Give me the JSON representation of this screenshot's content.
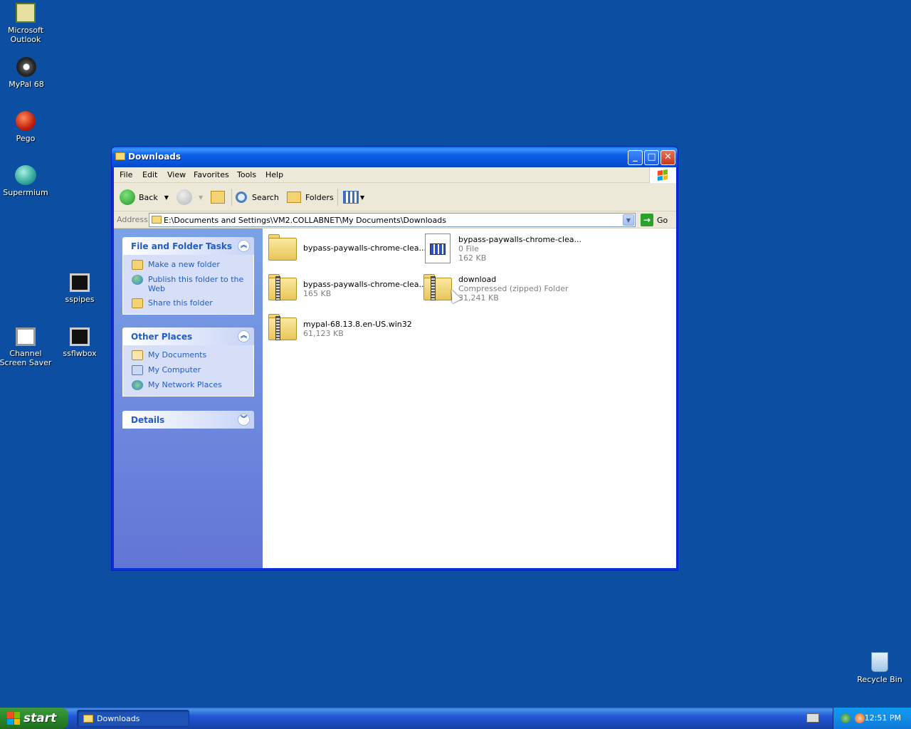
{
  "desktop": {
    "icons": [
      {
        "label": "Microsoft Outlook",
        "icon": "outlook-icon"
      },
      {
        "label": "MyPal 68",
        "icon": "mypal-icon"
      },
      {
        "label": "Pego",
        "icon": "pego-icon"
      },
      {
        "label": "Supermium",
        "icon": "supermium-icon"
      },
      {
        "label": "sspipes",
        "icon": "screensaver-monitor-icon"
      },
      {
        "label": "Channel Screen Saver",
        "icon": "monitor-icon"
      },
      {
        "label": "ssflwbox",
        "icon": "screensaver-monitor-icon"
      },
      {
        "label": "Recycle Bin",
        "icon": "recycle-bin-icon"
      }
    ]
  },
  "window": {
    "title": "Downloads",
    "controls": {
      "minimize": "_",
      "maximize": "□",
      "close": "✕"
    },
    "menu": [
      "File",
      "Edit",
      "View",
      "Favorites",
      "Tools",
      "Help"
    ],
    "toolbar": {
      "back": "Back",
      "search": "Search",
      "folders": "Folders"
    },
    "address": {
      "label": "Address",
      "value": "E:\\Documents and Settings\\VM2.COLLABNET\\My Documents\\Downloads",
      "go": "Go"
    },
    "task_panels": [
      {
        "title": "File and Folder Tasks",
        "links": [
          "Make a new folder",
          "Publish this folder to the Web",
          "Share this folder"
        ]
      },
      {
        "title": "Other Places",
        "links": [
          "My Documents",
          "My Computer",
          "My Network Places"
        ]
      },
      {
        "title": "Details",
        "links": []
      }
    ],
    "files": [
      {
        "name": "bypass-paywalls-chrome-clea...",
        "sub1": "",
        "sub2": "",
        "kind": "folder"
      },
      {
        "name": "bypass-paywalls-chrome-clea...",
        "sub1": "0 File",
        "sub2": "162 KB",
        "kind": "document"
      },
      {
        "name": "bypass-paywalls-chrome-clea...",
        "sub1": "165 KB",
        "sub2": "",
        "kind": "zip"
      },
      {
        "name": "download",
        "sub1": "Compressed (zipped) Folder",
        "sub2": "31,241 KB",
        "kind": "zip"
      },
      {
        "name": "mypal-68.13.8.en-US.win32",
        "sub1": "61,123 KB",
        "sub2": "",
        "kind": "zip"
      }
    ]
  },
  "taskbar": {
    "start": "start",
    "task": "Downloads",
    "clock": "12:51 PM"
  }
}
